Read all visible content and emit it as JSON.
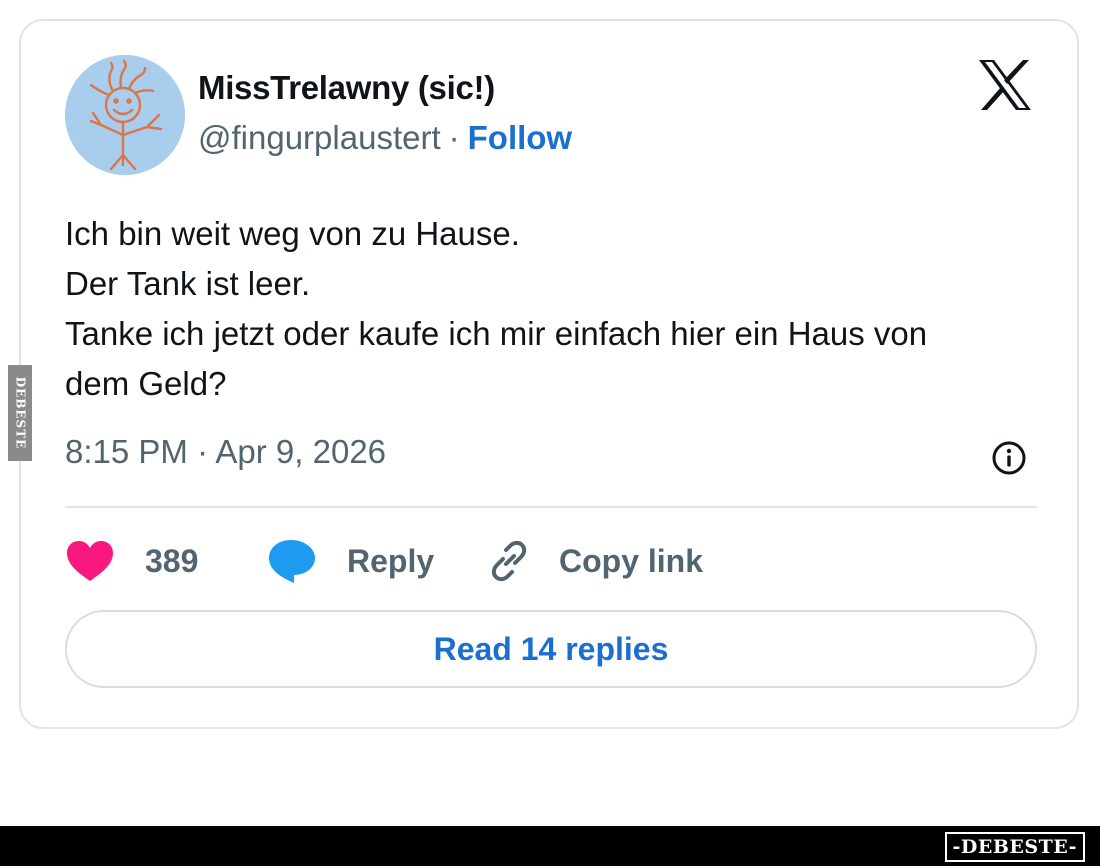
{
  "tweet": {
    "author": {
      "display_name": "MissTrelawny (sic!)",
      "handle": "@fingurplaustert",
      "separator": "·",
      "follow_label": "Follow"
    },
    "text_lines": [
      "Ich bin weit weg von zu Hause.",
      "Der Tank ist leer.",
      "Tanke ich jetzt oder kaufe ich mir einfach hier ein Haus von",
      "dem Geld?"
    ],
    "timestamp": "8:15 PM · Apr 9, 2026",
    "actions": {
      "likes_count": "389",
      "reply_label": "Reply",
      "copy_link_label": "Copy link"
    },
    "read_replies_label": "Read 14 replies"
  },
  "icons": {
    "brand": "x-logo-icon",
    "info": "info-icon",
    "like": "heart-icon",
    "reply": "speech-bubble-icon",
    "copy": "link-icon"
  },
  "colors": {
    "link_blue": "#1d6fcf",
    "heart_pink": "#f91880",
    "reply_blue": "#1d9bf0",
    "muted_text": "#536471",
    "avatar_bg": "#a9cdec"
  },
  "watermark": {
    "side_text": "DEBESTE",
    "footer_logo": "-DEBESTE-"
  }
}
